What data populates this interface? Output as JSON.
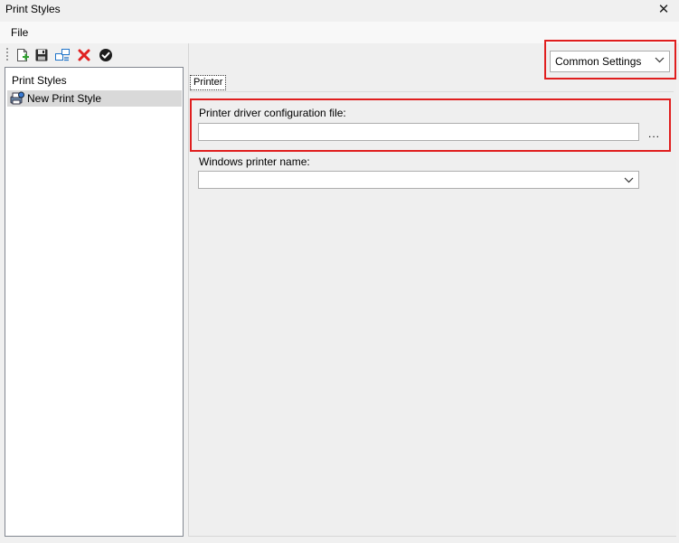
{
  "window": {
    "title": "Print Styles",
    "close_icon": "close-icon"
  },
  "menu": {
    "file_label": "File"
  },
  "toolbar": {
    "buttons": [
      {
        "name": "new-icon",
        "tooltip": ""
      },
      {
        "name": "save-icon",
        "tooltip": ""
      },
      {
        "name": "rename-icon",
        "tooltip": ""
      },
      {
        "name": "delete-icon",
        "tooltip": ""
      },
      {
        "name": "apply-icon",
        "tooltip": ""
      }
    ]
  },
  "tree": {
    "root_label": "Print Styles",
    "items": [
      {
        "label": "New Print Style",
        "icon": "print-style-icon"
      }
    ]
  },
  "settings_dropdown": {
    "value": "Common Settings"
  },
  "tabs": [
    {
      "label": "Printer"
    }
  ],
  "printer": {
    "driver_config_label": "Printer driver configuration file:",
    "driver_config_value": "",
    "browse_label": "...",
    "windows_printer_label": "Windows printer name:",
    "windows_printer_value": ""
  },
  "colors": {
    "highlight": "#e01e1e",
    "selection": "#d9d9d9"
  }
}
